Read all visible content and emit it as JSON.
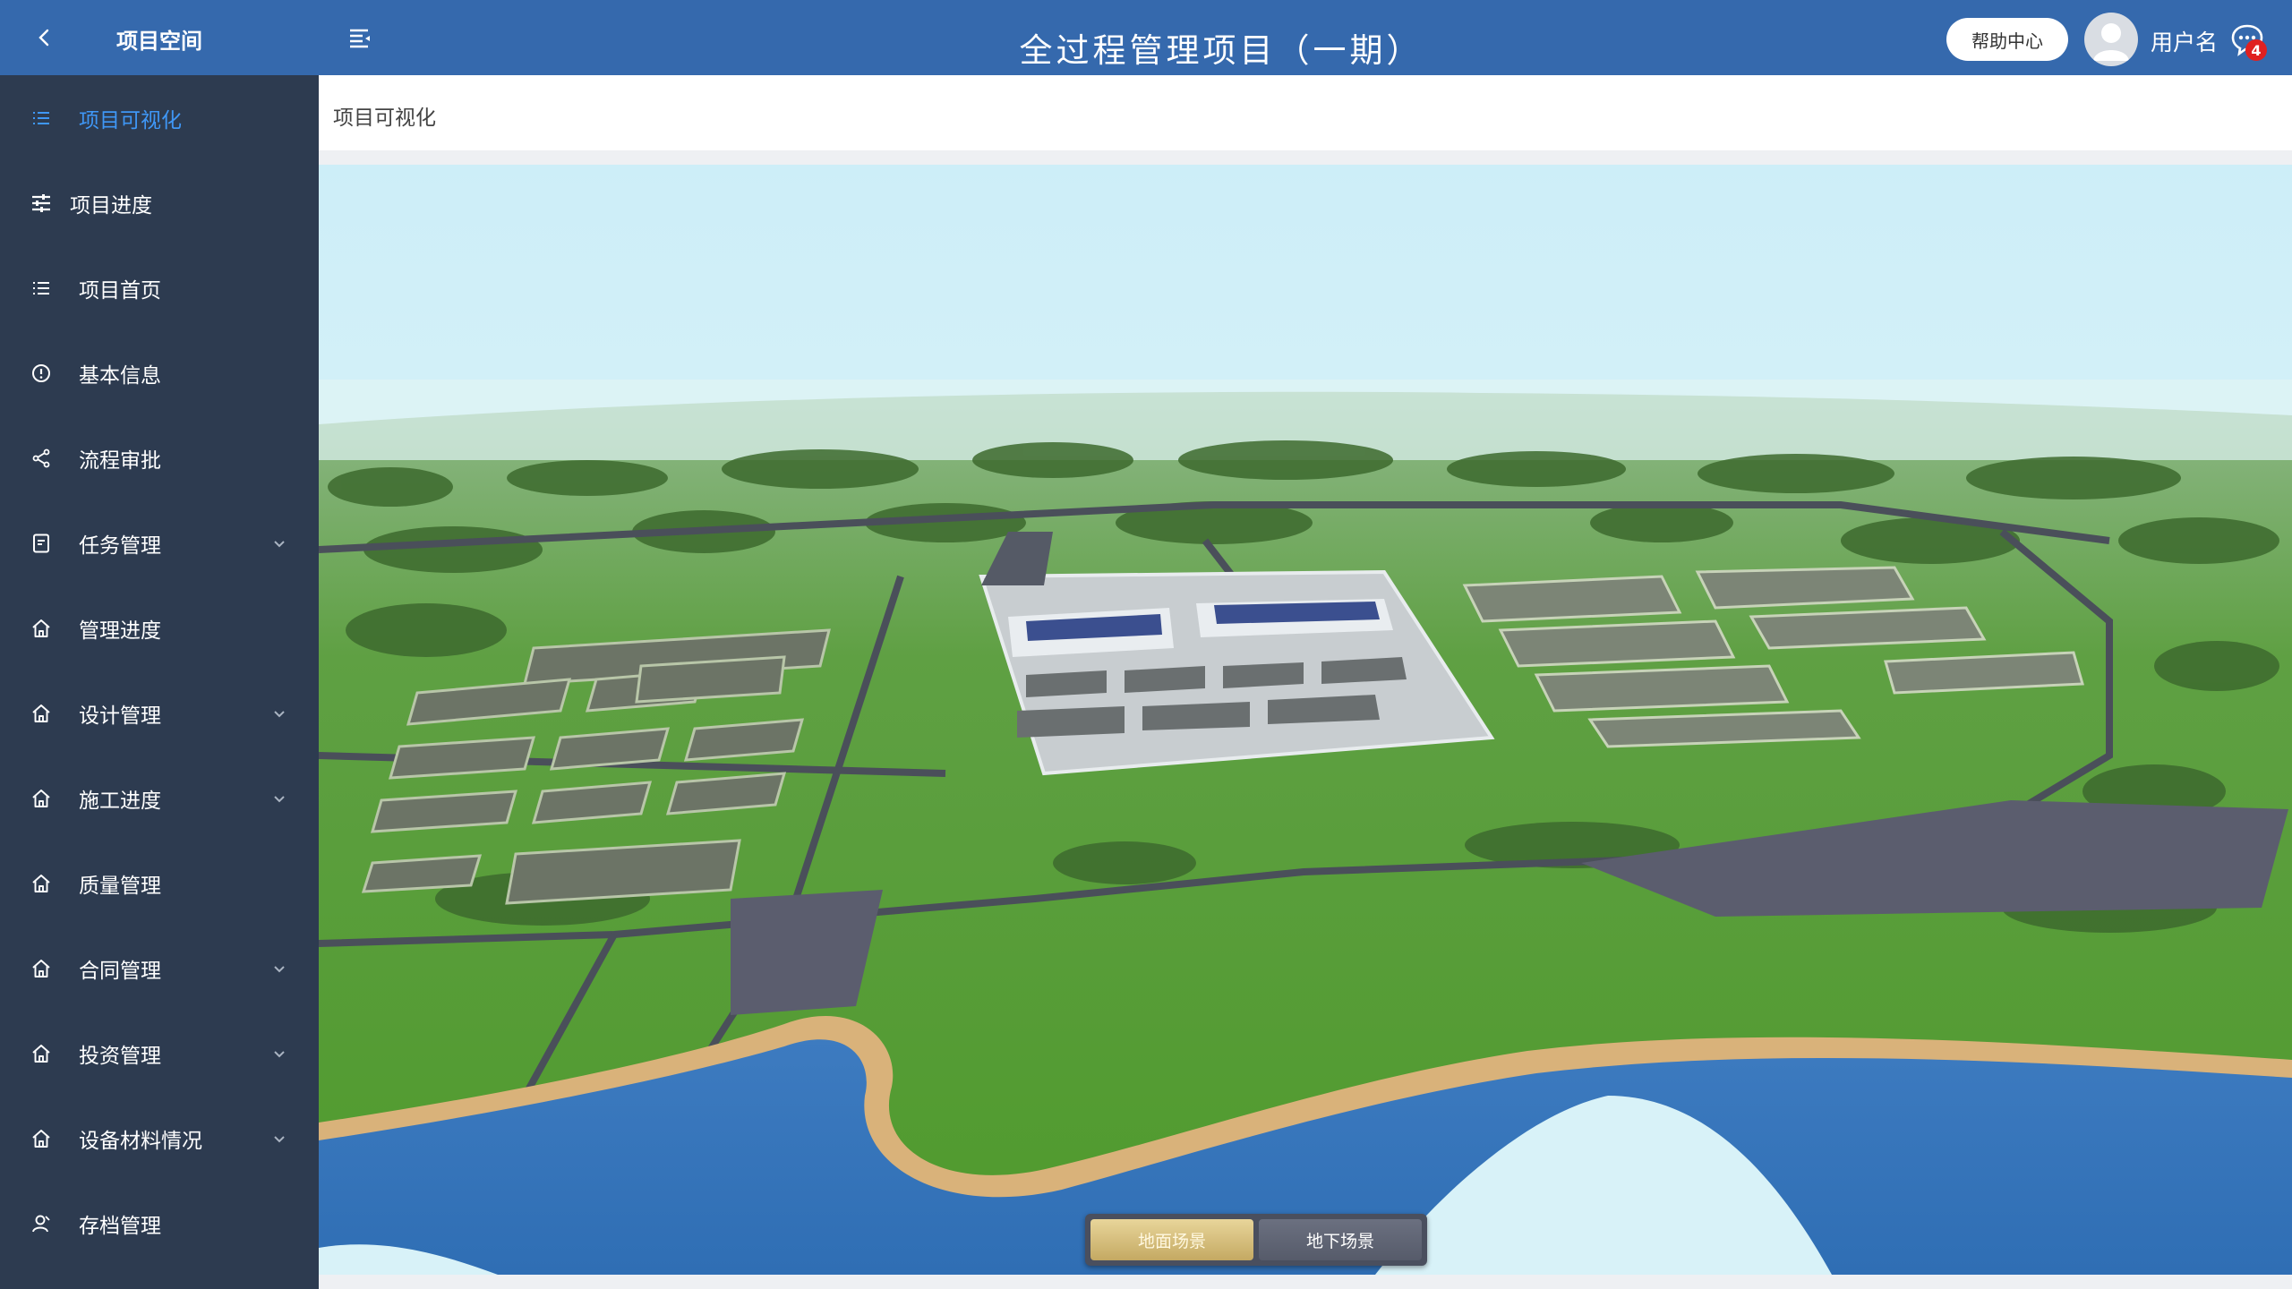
{
  "sidebar": {
    "title": "项目空间",
    "items": [
      {
        "label": "项目可视化",
        "icon": "list-icon",
        "active": true,
        "expandable": false
      },
      {
        "label": "项目进度",
        "icon": "sliders-icon",
        "active": false,
        "expandable": false
      },
      {
        "label": "项目首页",
        "icon": "list-icon",
        "active": false,
        "expandable": false
      },
      {
        "label": "基本信息",
        "icon": "info-circle-icon",
        "active": false,
        "expandable": false
      },
      {
        "label": "流程审批",
        "icon": "share-icon",
        "active": false,
        "expandable": false
      },
      {
        "label": "任务管理",
        "icon": "document-icon",
        "active": false,
        "expandable": true
      },
      {
        "label": "管理进度",
        "icon": "home-icon",
        "active": false,
        "expandable": false
      },
      {
        "label": "设计管理",
        "icon": "home-icon",
        "active": false,
        "expandable": true
      },
      {
        "label": "施工进度",
        "icon": "home-icon",
        "active": false,
        "expandable": true
      },
      {
        "label": "质量管理",
        "icon": "home-icon",
        "active": false,
        "expandable": false
      },
      {
        "label": "合同管理",
        "icon": "home-icon",
        "active": false,
        "expandable": true
      },
      {
        "label": "投资管理",
        "icon": "home-icon",
        "active": false,
        "expandable": true
      },
      {
        "label": "设备材料情况",
        "icon": "home-icon",
        "active": false,
        "expandable": true
      },
      {
        "label": "存档管理",
        "icon": "user-icon",
        "active": false,
        "expandable": false
      }
    ]
  },
  "header": {
    "title": "全过程管理项目（一期）",
    "help_label": "帮助中心",
    "username": "用户名",
    "message_count": "4"
  },
  "breadcrumb": "项目可视化",
  "scene_toggle": {
    "ground_label": "地面场景",
    "underground_label": "地下场景",
    "selected": "ground"
  },
  "colors": {
    "brand": "#3569ad",
    "sidebar_bg": "#2d3b50",
    "active_text": "#3f97f6",
    "badge": "#e02020"
  }
}
